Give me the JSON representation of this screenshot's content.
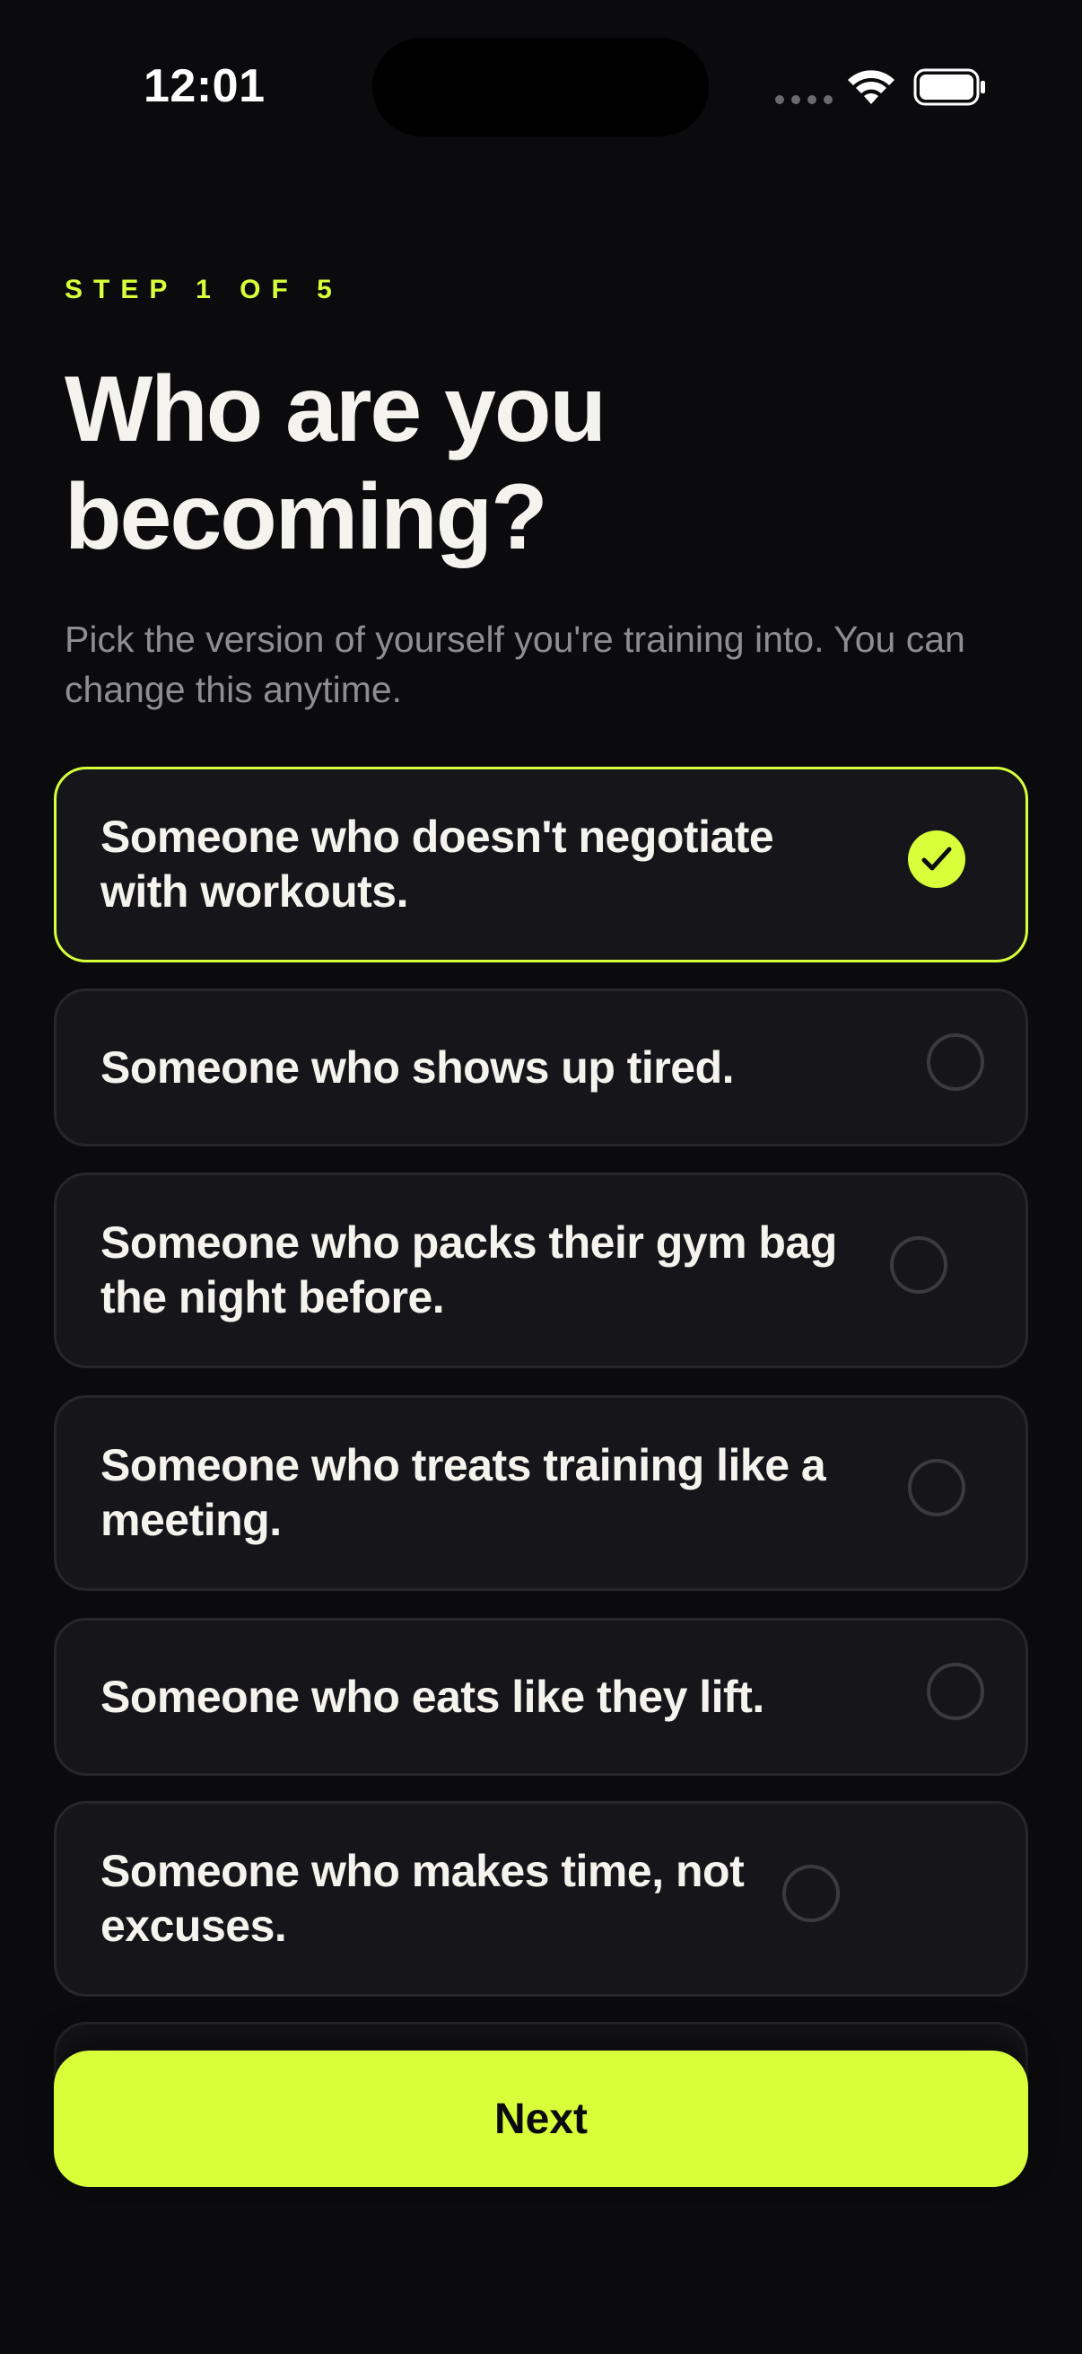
{
  "status_bar": {
    "time": "12:01"
  },
  "header": {
    "step": "STEP 1 OF 5",
    "title": "Who are you becoming?",
    "subtitle": "Pick the version of yourself you're training into. You can change this anytime."
  },
  "options": [
    {
      "label": "Someone who doesn't negotiate with workouts.",
      "selected": true
    },
    {
      "label": "Someone who shows up tired.",
      "selected": false
    },
    {
      "label": "Someone who packs their gym bag the night before.",
      "selected": false
    },
    {
      "label": "Someone who treats training like a meeting.",
      "selected": false
    },
    {
      "label": "Someone who eats like they lift.",
      "selected": false
    },
    {
      "label": "Someone who makes time, not excuses.",
      "selected": false
    }
  ],
  "next_button": {
    "label": "Next"
  },
  "colors": {
    "accent": "#d8ff3a",
    "background": "#0b0b0d",
    "card": "#16161a"
  }
}
